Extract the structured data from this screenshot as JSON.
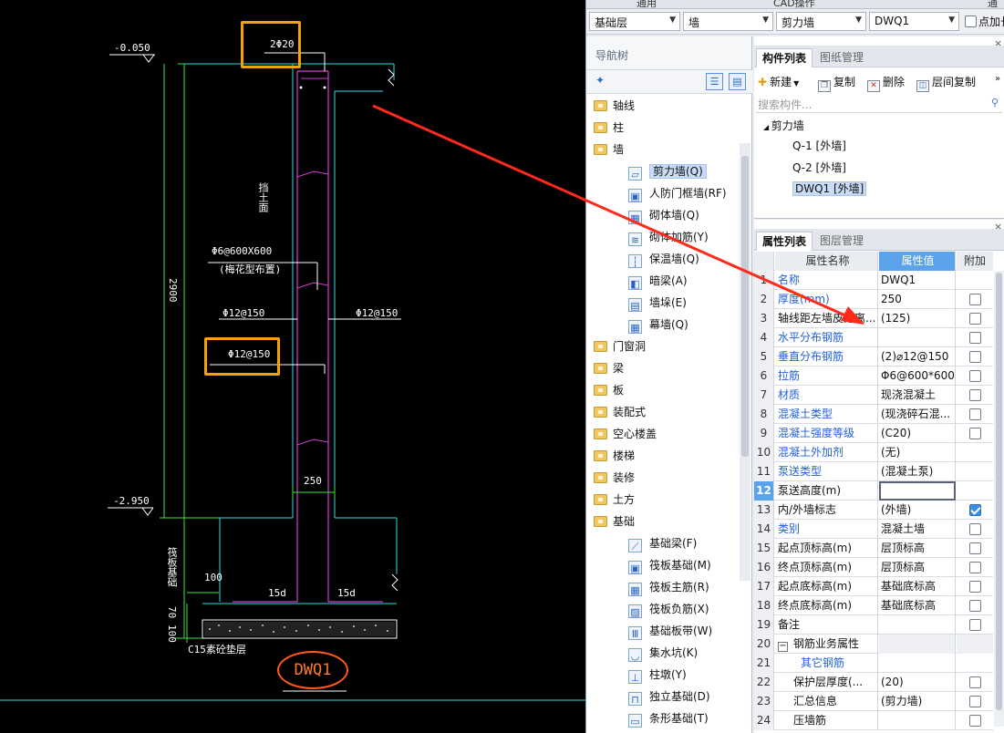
{
  "cad": {
    "elev_top": "-0.050",
    "elev_bottom": "-2.950",
    "top_rebar": "2Φ20",
    "backfill_label": "挡土面",
    "tie_spec": "Φ6@600X600",
    "tie_note": "(梅花型布置)",
    "left_rebar": "Φ12@150",
    "right_rebar": "Φ12@150",
    "box_rebar": "Φ12@150",
    "height_dim": "2900",
    "wall_thickness": "250",
    "anchor_left": "15d",
    "anchor_right": "15d",
    "dim_100": "100",
    "dim_70": "70",
    "dim_100b": "100",
    "cushion_label": "C15素砼垫层",
    "foundation_label": "筏板基础",
    "title": "DWQ1"
  },
  "menubar": {
    "items": [
      "通用",
      "CAD操作",
      "通"
    ]
  },
  "selectors": {
    "floor": "基础层",
    "category": "墙",
    "type": "剪力墙",
    "component": "DWQ1",
    "checkbox_label": "点加长"
  },
  "nav": {
    "title": "导航树",
    "items": [
      {
        "label": "轴线",
        "level": 0
      },
      {
        "label": "柱",
        "level": 0
      },
      {
        "label": "墙",
        "level": 0
      },
      {
        "label": "剪力墙(Q)",
        "level": 1,
        "icon": "▱",
        "selected": true
      },
      {
        "label": "人防门框墙(RF)",
        "level": 1,
        "icon": "▣"
      },
      {
        "label": "砌体墙(Q)",
        "level": 1,
        "icon": "▦"
      },
      {
        "label": "砌体加筋(Y)",
        "level": 1,
        "icon": "≋"
      },
      {
        "label": "保温墙(Q)",
        "level": 1,
        "icon": "┆"
      },
      {
        "label": "暗梁(A)",
        "level": 1,
        "icon": "◧"
      },
      {
        "label": "墙垛(E)",
        "level": 1,
        "icon": "▤"
      },
      {
        "label": "幕墙(Q)",
        "level": 1,
        "icon": "▦"
      },
      {
        "label": "门窗洞",
        "level": 0
      },
      {
        "label": "梁",
        "level": 0
      },
      {
        "label": "板",
        "level": 0
      },
      {
        "label": "装配式",
        "level": 0
      },
      {
        "label": "空心楼盖",
        "level": 0
      },
      {
        "label": "楼梯",
        "level": 0
      },
      {
        "label": "装修",
        "level": 0
      },
      {
        "label": "土方",
        "level": 0
      },
      {
        "label": "基础",
        "level": 0
      },
      {
        "label": "基础梁(F)",
        "level": 1,
        "icon": "⟋"
      },
      {
        "label": "筏板基础(M)",
        "level": 1,
        "icon": "▣"
      },
      {
        "label": "筏板主筋(R)",
        "level": 1,
        "icon": "▦"
      },
      {
        "label": "筏板负筋(X)",
        "level": 1,
        "icon": "▨"
      },
      {
        "label": "基础板带(W)",
        "level": 1,
        "icon": "Ⅲ"
      },
      {
        "label": "集水坑(K)",
        "level": 1,
        "icon": "◡"
      },
      {
        "label": "柱墩(Y)",
        "level": 1,
        "icon": "⊥"
      },
      {
        "label": "独立基础(D)",
        "level": 1,
        "icon": "⊓"
      },
      {
        "label": "条形基础(T)",
        "level": 1,
        "icon": "▭"
      }
    ]
  },
  "comp": {
    "tabs": [
      "构件列表",
      "图纸管理"
    ],
    "toolbar": {
      "new": "新建",
      "copy": "复制",
      "delete": "删除",
      "floor_copy": "层间复制"
    },
    "search_placeholder": "搜索构件...",
    "tree": [
      {
        "label": "剪力墙",
        "level": 0
      },
      {
        "label": "Q-1 [外墙]",
        "level": 1
      },
      {
        "label": "Q-2 [外墙]",
        "level": 1
      },
      {
        "label": "DWQ1 [外墙]",
        "level": 1,
        "selected": true
      }
    ]
  },
  "props": {
    "tabs": [
      "属性列表",
      "图层管理"
    ],
    "headers": {
      "name": "属性名称",
      "value": "属性值",
      "extra": "附加"
    },
    "rows": [
      {
        "n": "1",
        "name": "名称",
        "value": "DWQ1",
        "blue": true,
        "chk": "none"
      },
      {
        "n": "2",
        "name": "厚度(mm)",
        "value": "250",
        "blue": true,
        "chk": "off"
      },
      {
        "n": "3",
        "name": "轴线距左墙皮距离...",
        "value": "(125)",
        "blue": false,
        "chk": "off"
      },
      {
        "n": "4",
        "name": "水平分布钢筋",
        "value": "",
        "blue": true,
        "chk": "off"
      },
      {
        "n": "5",
        "name": "垂直分布钢筋",
        "value": "(2)⌀12@150",
        "blue": true,
        "chk": "off"
      },
      {
        "n": "6",
        "name": "拉筋",
        "value": "Φ6@600*600",
        "blue": true,
        "chk": "off"
      },
      {
        "n": "7",
        "name": "材质",
        "value": "现浇混凝土",
        "blue": true,
        "chk": "off"
      },
      {
        "n": "8",
        "name": "混凝土类型",
        "value": "(现浇碎石混...",
        "blue": true,
        "chk": "off"
      },
      {
        "n": "9",
        "name": "混凝土强度等级",
        "value": "(C20)",
        "blue": true,
        "chk": "off"
      },
      {
        "n": "10",
        "name": "混凝土外加剂",
        "value": "(无)",
        "blue": true,
        "chk": "none"
      },
      {
        "n": "11",
        "name": "泵送类型",
        "value": "(混凝土泵)",
        "blue": true,
        "chk": "none"
      },
      {
        "n": "12",
        "name": "泵送高度(m)",
        "value": "",
        "blue": false,
        "chk": "none",
        "current": true
      },
      {
        "n": "13",
        "name": "内/外墙标志",
        "value": "(外墙)",
        "blue": false,
        "chk": "on"
      },
      {
        "n": "14",
        "name": "类别",
        "value": "混凝土墙",
        "blue": true,
        "chk": "off"
      },
      {
        "n": "15",
        "name": "起点顶标高(m)",
        "value": "层顶标高",
        "blue": false,
        "chk": "off"
      },
      {
        "n": "16",
        "name": "终点顶标高(m)",
        "value": "层顶标高",
        "blue": false,
        "chk": "off"
      },
      {
        "n": "17",
        "name": "起点底标高(m)",
        "value": "基础底标高",
        "blue": false,
        "chk": "off"
      },
      {
        "n": "18",
        "name": "终点底标高(m)",
        "value": "基础底标高",
        "blue": false,
        "chk": "off"
      },
      {
        "n": "19",
        "name": "备注",
        "value": "",
        "blue": false,
        "chk": "off"
      },
      {
        "n": "20",
        "name": "钢筋业务属性",
        "value": "",
        "blue": false,
        "chk": "none",
        "group": true
      },
      {
        "n": "21",
        "name": "其它钢筋",
        "value": "",
        "blue": true,
        "chk": "none",
        "indent": true
      },
      {
        "n": "22",
        "name": "保护层厚度(...",
        "value": "(20)",
        "blue": false,
        "chk": "off",
        "indent": true
      },
      {
        "n": "23",
        "name": "汇总信息",
        "value": "(剪力墙)",
        "blue": false,
        "chk": "off",
        "indent": true
      },
      {
        "n": "24",
        "name": "压墙筋",
        "value": "",
        "blue": false,
        "chk": "off",
        "indent": true
      }
    ]
  },
  "colors": {
    "accent": "#5aa2ea",
    "arrow": "#ff2a1a",
    "highlight_box": "#f3a20f",
    "wall_line": "#d23cd2",
    "slab_line": "#2ce0e6",
    "dim_line": "#41e341"
  }
}
